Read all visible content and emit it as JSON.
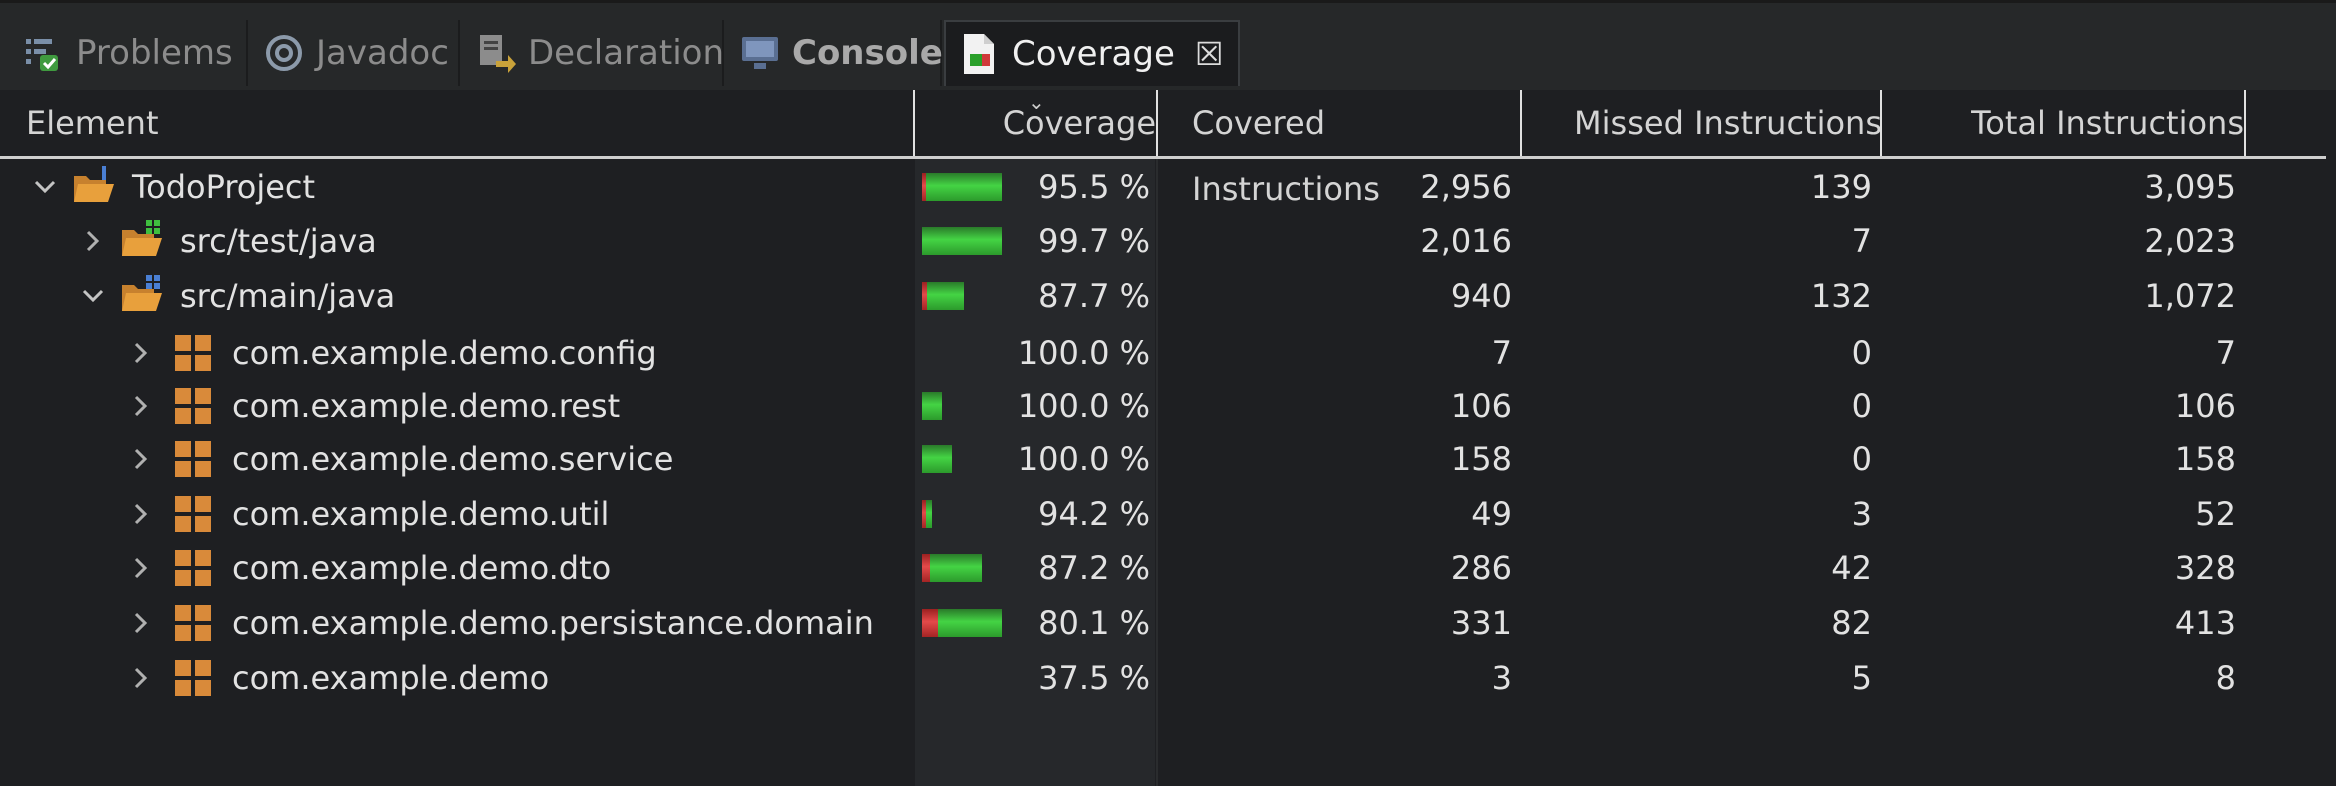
{
  "tabs": [
    {
      "label": "Problems",
      "icon": "problems-icon"
    },
    {
      "label": "Javadoc",
      "icon": "at-icon"
    },
    {
      "label": "Declaration",
      "icon": "declaration-icon"
    },
    {
      "label": "Console",
      "icon": "console-icon"
    },
    {
      "label": "Coverage",
      "icon": "coverage-icon",
      "close": "☒"
    }
  ],
  "columns": {
    "element": "Element",
    "coverage": "Coverage",
    "covered": "Covered Instructions",
    "missed": "Missed Instructions",
    "total": "Total Instructions"
  },
  "rows": [
    {
      "name": "TodoProject",
      "coverage": "95.5 %",
      "covered": "2,956",
      "missed": "139",
      "total": "3,095",
      "coverage_fraction": 0.955,
      "expanded": true
    },
    {
      "name": "src/test/java",
      "coverage": "99.7 %",
      "covered": "2,016",
      "missed": "7",
      "total": "2,023",
      "coverage_fraction": 0.997,
      "expanded": false
    },
    {
      "name": "src/main/java",
      "coverage": "87.7 %",
      "covered": "940",
      "missed": "132",
      "total": "1,072",
      "coverage_fraction": 0.877,
      "expanded": true
    },
    {
      "name": "com.example.demo.config",
      "coverage": "100.0 %",
      "covered": "7",
      "missed": "0",
      "total": "7",
      "coverage_fraction": 1.0
    },
    {
      "name": "com.example.demo.rest",
      "coverage": "100.0 %",
      "covered": "106",
      "missed": "0",
      "total": "106",
      "coverage_fraction": 1.0
    },
    {
      "name": "com.example.demo.service",
      "coverage": "100.0 %",
      "covered": "158",
      "missed": "0",
      "total": "158",
      "coverage_fraction": 1.0
    },
    {
      "name": "com.example.demo.util",
      "coverage": "94.2 %",
      "covered": "49",
      "missed": "3",
      "total": "52",
      "coverage_fraction": 0.942
    },
    {
      "name": "com.example.demo.dto",
      "coverage": "87.2 %",
      "covered": "286",
      "missed": "42",
      "total": "328",
      "coverage_fraction": 0.872
    },
    {
      "name": "com.example.demo.persistance.domain",
      "coverage": "80.1 %",
      "covered": "331",
      "missed": "82",
      "total": "413",
      "coverage_fraction": 0.801
    },
    {
      "name": "com.example.demo",
      "coverage": "37.5 %",
      "covered": "3",
      "missed": "5",
      "total": "8",
      "coverage_fraction": 0.375
    }
  ],
  "colors": {
    "covered": "#44d444",
    "missed": "#e44a4a",
    "folder": "#e8a03c",
    "package": "#d98a3a"
  }
}
